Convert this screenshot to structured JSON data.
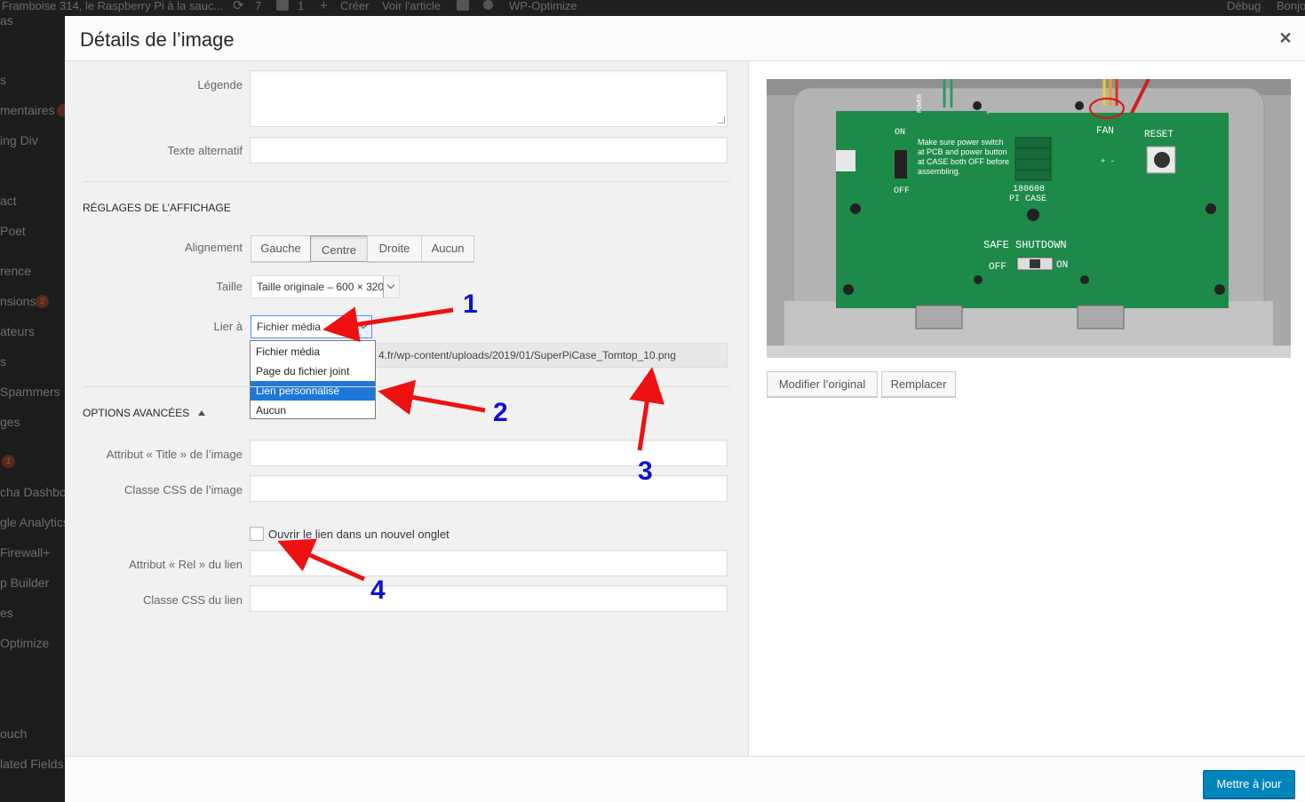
{
  "admin_bar": {
    "site_name": "Framboise 314, le Raspberry Pi à la sauc...",
    "updates_count": "7",
    "comments_count": "1",
    "new_label": "Créer",
    "view_post": "Voir l'article",
    "wp_optimize": "WP-Optimize",
    "debug": "Débug",
    "greeting": "Bonjo",
    "subline": "as"
  },
  "side_menu": {
    "items": [
      "s",
      "mentaires",
      "ing Div",
      "act",
      "Poet",
      "rence",
      "nsions",
      "ateurs",
      "s",
      "Spammers",
      "ges",
      "",
      "cha Dashboa",
      "gle Analytics",
      "Firewall+",
      "p Builder",
      "es",
      "Optimize",
      "ouch",
      "lated Fields"
    ],
    "badges": [
      "",
      "2",
      "1"
    ]
  },
  "modal": {
    "title": "Détails de l’image",
    "close_icon": "close-icon"
  },
  "fields": {
    "caption_label": "Légende",
    "caption_value": "",
    "alt_label": "Texte alternatif",
    "alt_value": ""
  },
  "display_settings": {
    "heading": "RÉGLAGES DE L’AFFICHAGE",
    "align_label": "Alignement",
    "align_options": [
      "Gauche",
      "Centre",
      "Droite",
      "Aucun"
    ],
    "align_selected": "Centre",
    "size_label": "Taille",
    "size_value": "Taille originale – 600 × 320",
    "link_label": "Lier à",
    "link_value": "Fichier média",
    "link_options": [
      "Fichier média",
      "Page du fichier joint",
      "Lien personnalisé",
      "Aucun"
    ],
    "link_highlighted": "Lien personnalisé",
    "link_url": "4.fr/wp-content/uploads/2019/01/SuperPiCase_Tomtop_10.png"
  },
  "advanced": {
    "heading": "OPTIONS AVANCÉES",
    "title_attr_label": "Attribut « Title » de l’image",
    "title_attr_value": "",
    "css_class_label": "Classe CSS de l’image",
    "css_class_value": "",
    "new_tab_label": "Ouvrir le lien dans un nouvel onglet",
    "new_tab_checked": false,
    "rel_label": "Attribut « Rel » du lien",
    "rel_value": "",
    "link_css_label": "Classe CSS du lien",
    "link_css_value": ""
  },
  "preview": {
    "pcb_power": "POWER",
    "pcb_on": "ON",
    "pcb_off": "OFF",
    "pcb_note_1": "Make sure power switch",
    "pcb_note_2": "at PCB and power button",
    "pcb_note_3": "at CASE both OFF before",
    "pcb_note_4": "assembling.",
    "pcb_fan": "FAN",
    "pcb_reset": "RESET",
    "pcb_plus_minus": "+ -",
    "pcb_model_1": "180608",
    "pcb_model_2": "PI CASE",
    "pcb_safe": "SAFE SHUTDOWN",
    "pcb_off2": "OFF",
    "pcb_on2": "ON",
    "edit_original": "Modifier l’original",
    "replace": "Remplacer"
  },
  "footer": {
    "update_label": "Mettre à jour"
  },
  "annotations": {
    "labels": [
      "1",
      "2",
      "3",
      "4"
    ],
    "arrow_color": "#ee1111",
    "number_color": "#1010d0"
  }
}
